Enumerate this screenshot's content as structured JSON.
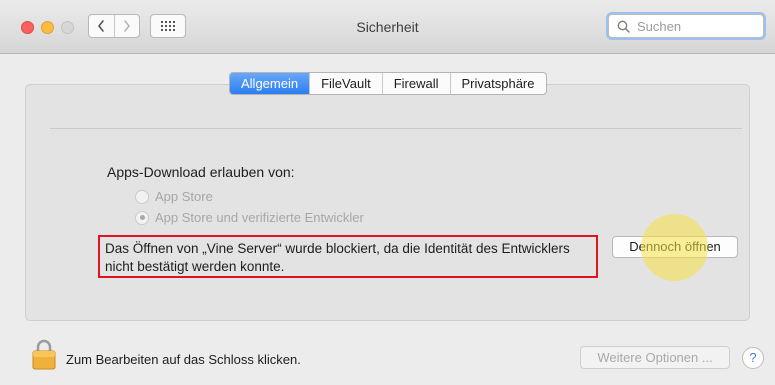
{
  "window": {
    "title": "Sicherheit"
  },
  "toolbar": {
    "back_icon": "chevron-left",
    "forward_icon": "chevron-right",
    "show_all_icon": "grid"
  },
  "search": {
    "placeholder": "Suchen",
    "value": ""
  },
  "tabs": [
    {
      "label": "Allgemein",
      "active": true
    },
    {
      "label": "FileVault",
      "active": false
    },
    {
      "label": "Firewall",
      "active": false
    },
    {
      "label": "Privatsphäre",
      "active": false
    }
  ],
  "general": {
    "download_label": "Apps-Download erlauben von:",
    "options": [
      {
        "label": "App Store",
        "selected": false,
        "enabled": false
      },
      {
        "label": "App Store und verifizierte Entwickler",
        "selected": true,
        "enabled": false
      }
    ],
    "blocked_message_line1": "Das Öffnen von „Vine Server“ wurde blockiert, da die Identität des Entwicklers",
    "blocked_message_line2": "nicht bestätigt werden konnte.",
    "open_anyway_label": "Dennoch öffnen"
  },
  "footer": {
    "lock_label": "Zum Bearbeiten auf das Schloss klicken.",
    "more_options_label": "Weitere Optionen ...",
    "help_label": "?"
  },
  "colors": {
    "accent": "#2b7ef2",
    "alert_border": "#e0141e",
    "cursor_highlight": "#f7e046"
  }
}
